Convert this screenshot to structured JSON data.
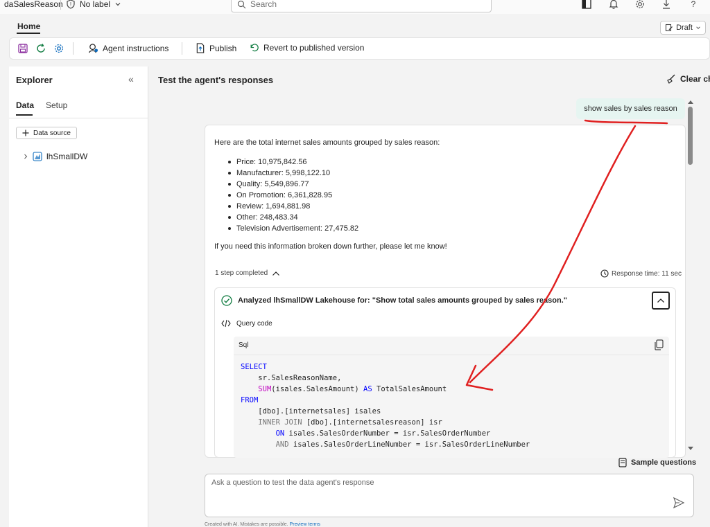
{
  "topbar": {
    "app_name": "daSalesReason",
    "label": "No label",
    "search_placeholder": "Search"
  },
  "tabs": {
    "home": "Home",
    "draft": "Draft"
  },
  "toolbar": {
    "agent_instructions": "Agent instructions",
    "publish": "Publish",
    "revert": "Revert to published version"
  },
  "explorer": {
    "title": "Explorer",
    "tab_data": "Data",
    "tab_setup": "Setup",
    "data_source": "Data source",
    "tree_item": "lhSmallDW"
  },
  "main": {
    "title": "Test the agent's responses",
    "clear_chat": "Clear cha",
    "user_message": "show sales by sales reason",
    "answer_intro": "Here are the total internet sales amounts grouped by sales reason:",
    "bullets": [
      "Price: 10,975,842.56",
      "Manufacturer: 5,998,122.10",
      "Quality: 5,549,896.77",
      "On Promotion: 6,361,828.95",
      "Review: 1,694,881.98",
      "Other: 248,483.34",
      "Television Advertisement: 27,475.82"
    ],
    "outro": "If you need this information broken down further, please let me know!",
    "steps": "1 step completed",
    "response_time": "Response time: 11 sec",
    "analyzed": "Analyzed lhSmallDW Lakehouse for: \"Show total sales amounts grouped by sales reason.\"",
    "query_code": "Query code",
    "code_lang": "Sql",
    "sample_questions": "Sample questions",
    "ask_placeholder": "Ask a question to test the data agent's response",
    "footer_text": "Created with AI. Mistakes are possible.",
    "footer_link": "Preview terms"
  },
  "code_lines": {
    "l1": "SELECT",
    "l2": "    sr.SalesReasonName,",
    "l3_fn": "SUM",
    "l3_rest": "(isales.SalesAmount) ",
    "l3_kw": "AS",
    "l3_end": " TotalSalesAmount",
    "l4": "FROM",
    "l5": "    [dbo].[internetsales] isales",
    "l6_op": "INNER JOIN",
    "l6_rest": " [dbo].[internetsalesreason] isr",
    "l7_kw": "ON",
    "l7_rest": " isales.SalesOrderNumber = isr.SalesOrderNumber",
    "l8_op": "AND",
    "l8_rest": " isales.SalesOrderLineNumber = isr.SalesOrderLineNumber"
  },
  "colors": {
    "accent_teal": "#e6f5f1",
    "annotation_red": "#e02020",
    "keyword_blue": "#0000ff"
  }
}
